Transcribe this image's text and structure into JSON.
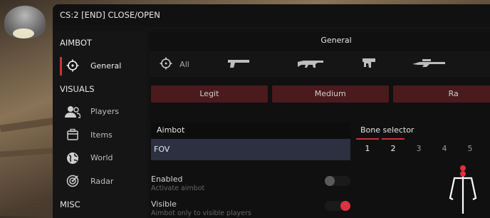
{
  "window": {
    "title": "CS:2 [END] CLOSE/OPEN"
  },
  "sidebar": {
    "aimbot_section": "AIMBOT",
    "aimbot_items": [
      {
        "label": "General",
        "icon": "crosshair-icon",
        "active": true
      }
    ],
    "visuals_section": "VISUALS",
    "visuals_items": [
      {
        "label": "Players",
        "icon": "players-icon"
      },
      {
        "label": "Items",
        "icon": "items-icon"
      },
      {
        "label": "World",
        "icon": "world-icon"
      },
      {
        "label": "Radar",
        "icon": "radar-icon"
      }
    ],
    "misc_section": "MISC"
  },
  "main": {
    "header": "General",
    "weapons": [
      {
        "label": "All",
        "icon": "crosshair-icon"
      },
      {
        "label": "",
        "icon": "pistol-icon"
      },
      {
        "label": "",
        "icon": "rifle-icon"
      },
      {
        "label": "",
        "icon": "smg-icon"
      },
      {
        "label": "",
        "icon": "sniper-icon"
      }
    ],
    "modes": [
      "Legit",
      "Medium",
      "Ra"
    ],
    "aimbot": {
      "header": "Aimbot",
      "fov_label": "FOV",
      "options": [
        {
          "title": "Enabled",
          "subtitle": "Activate aimbot",
          "on": false
        },
        {
          "title": "Visible",
          "subtitle": "Aimbot only to visible players",
          "on": true
        }
      ]
    },
    "bone_selector": {
      "header": "Bone selector",
      "tabs": [
        "1",
        "2",
        "3",
        "4",
        "5"
      ],
      "selected_tabs": [
        "1",
        "2"
      ]
    }
  },
  "colors": {
    "accent": "#c8333a",
    "mode_button": "#4a1a1d",
    "fov_row": "#2c3040",
    "background": "#131313"
  }
}
